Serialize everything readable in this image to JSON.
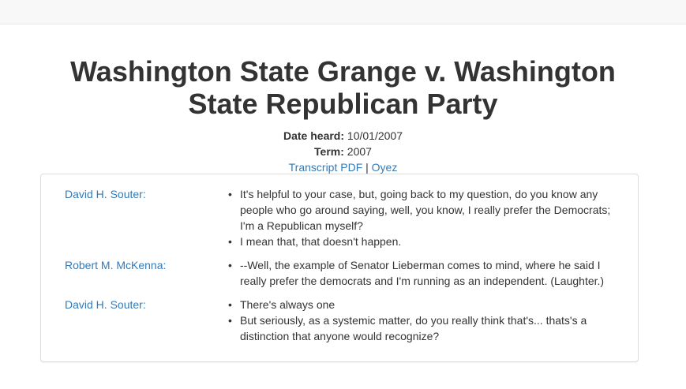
{
  "case": {
    "title": "Washington State Grange v. Washington State Republican Party",
    "date_heard_label": "Date heard:",
    "date_heard": "10/01/2007",
    "term_label": "Term:",
    "term": "2007",
    "transcript_link": "Transcript PDF",
    "separator": "|",
    "oyez_link": "Oyez"
  },
  "transcript": [
    {
      "speaker": "David H. Souter:",
      "lines": [
        "It's helpful to your case, but, going back to my question, do you know any people who go around saying, well, you know, I really prefer the Democrats; I'm a Republican myself?",
        "I mean that, that doesn't happen."
      ]
    },
    {
      "speaker": "Robert M. McKenna:",
      "lines": [
        "--Well, the example of Senator Lieberman comes to mind, where he said I really prefer the democrats and I'm running as an independent. (Laughter.)"
      ]
    },
    {
      "speaker": "David H. Souter:",
      "lines": [
        "There's always one",
        "But seriously, as a systemic matter, do you really think that's... thats's a distinction that anyone would recognize?"
      ]
    }
  ],
  "colors": {
    "link": "#337ab7",
    "text": "#333333",
    "border": "#dddddd"
  }
}
